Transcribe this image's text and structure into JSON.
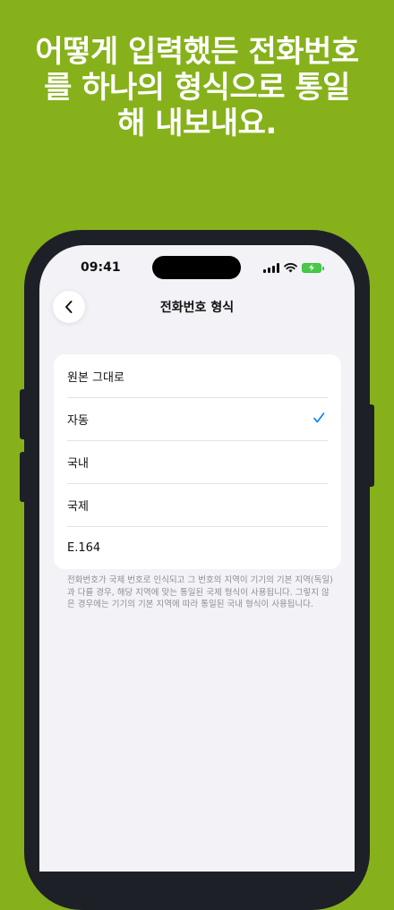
{
  "headline": {
    "line1": "어떻게 입력했든 전화번호",
    "line2": "를 하나의 형식으로 통일",
    "line3": "해 내보내요."
  },
  "status_bar": {
    "time": "09:41"
  },
  "nav": {
    "back_icon": "chevron-left-icon",
    "title": "전화번호 형식"
  },
  "options": [
    {
      "label": "원본 그대로",
      "selected": false
    },
    {
      "label": "자동",
      "selected": true
    },
    {
      "label": "국내",
      "selected": false
    },
    {
      "label": "국제",
      "selected": false
    },
    {
      "label": "E.164",
      "selected": false
    }
  ],
  "footnote": "전화번호가 국제 번호로 인식되고 그 번호의 지역이 기기의 기본 지역(독일)과 다를 경우, 해당 지역에 맞는 통일된 국제 형식이 사용됩니다. 그렇지 않은 경우에는 기기의 기본 지역에 따라 통일된 국내 형식이 사용됩니다.",
  "colors": {
    "background": "#86b11b",
    "accent": "#007aff",
    "battery": "#48c848"
  }
}
